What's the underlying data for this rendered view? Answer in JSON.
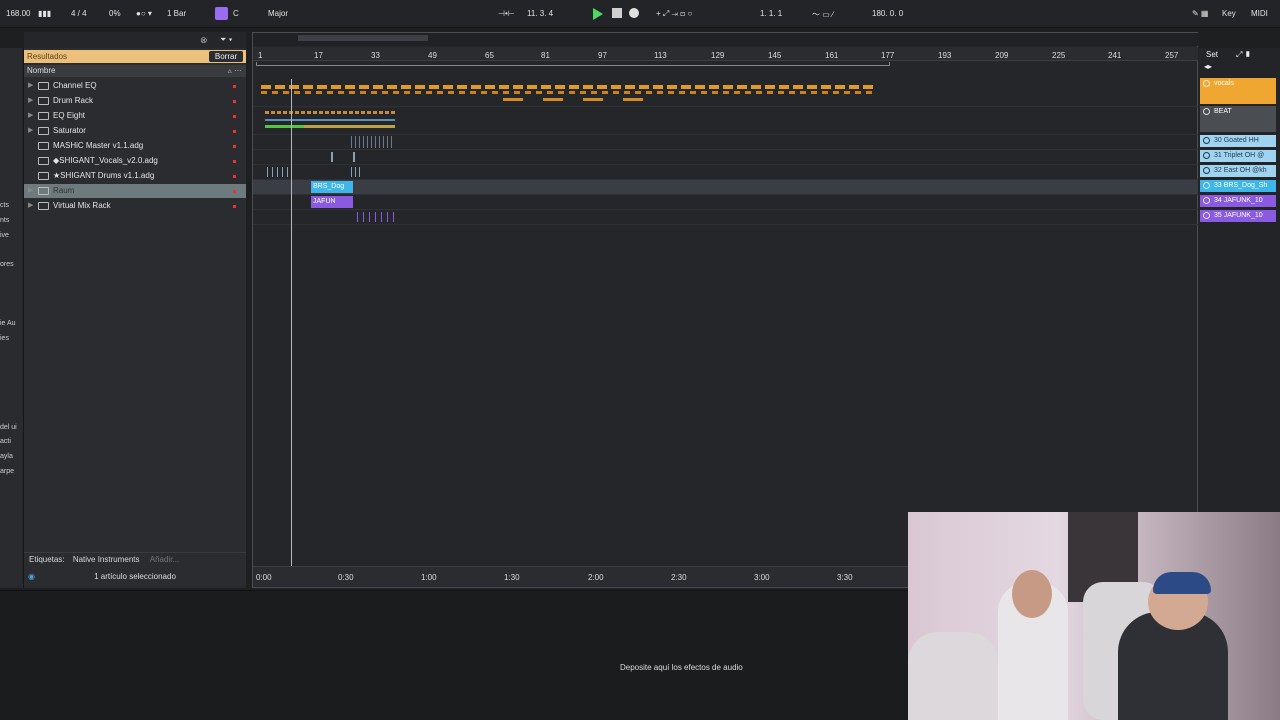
{
  "toolbar": {
    "tempo": "168.00",
    "time_signature": "4 / 4",
    "cpu": "0%",
    "quantize": "1 Bar",
    "key": "C",
    "scale": "Major",
    "position": "11.   3.   4",
    "loop_start": "1.   1.   1",
    "loop_length": "180.   0.   0",
    "key_button": "Key",
    "midi_button": "MIDI"
  },
  "left_strip": [
    "cts",
    "nts",
    "ive",
    "ores",
    "ie Au",
    "ies",
    "del ui",
    "acti",
    "ayla",
    "arpe"
  ],
  "browser": {
    "results_label": "Resultados",
    "clear_button": "Borrar",
    "name_header": "Nombre",
    "items": [
      {
        "label": "Channel EQ",
        "selected": false
      },
      {
        "label": "Drum Rack",
        "selected": false
      },
      {
        "label": "EQ Eight",
        "selected": false
      },
      {
        "label": "Saturator",
        "selected": false
      },
      {
        "label": "MASHiC Master v1.1.adg",
        "selected": false
      },
      {
        "label": "◆SHIGANT_Vocals_v2.0.adg",
        "selected": false
      },
      {
        "label": "★SHIGANT Drums v1.1.adg",
        "selected": false
      },
      {
        "label": "Raum",
        "selected": true
      },
      {
        "label": "Virtual Mix Rack",
        "selected": false
      }
    ],
    "tags_label": "Etiquetas:",
    "tag_value": "Native Instruments",
    "tag_add": "Añadir...",
    "status": "1 artículo seleccionado"
  },
  "arrangement": {
    "bar_numbers": [
      "1",
      "17",
      "33",
      "49",
      "65",
      "81",
      "97",
      "113",
      "129",
      "145",
      "161",
      "177",
      "193",
      "209",
      "225",
      "241",
      "257"
    ],
    "time_marks": [
      "0:00",
      "0:30",
      "1:00",
      "1:30",
      "2:00",
      "2:30",
      "3:00",
      "3:30"
    ],
    "set_button": "Set",
    "clips": [
      {
        "label": "BRS_Dog",
        "color": "#3fb6e8"
      },
      {
        "label": "JAFUN",
        "color": "#8a5be0"
      }
    ]
  },
  "tracks": [
    {
      "label": "vocals",
      "color": "#f0a732"
    },
    {
      "label": "BEAT",
      "color": "#4a4d52"
    },
    {
      "label": "30 Goated HH",
      "color": "#9fd3f0"
    },
    {
      "label": "31 Triplet OH @",
      "color": "#9fd3f0"
    },
    {
      "label": "32 East OH @kh",
      "color": "#9fd3f0"
    },
    {
      "label": "33 BRS_Dog_Sh",
      "color": "#3fb6e8"
    },
    {
      "label": "34 JAFUNK_10",
      "color": "#8a5be0"
    },
    {
      "label": "35 JAFUNK_10",
      "color": "#8a5be0"
    }
  ],
  "device_area": {
    "drop_text": "Deposite aquí los efectos de audio"
  }
}
